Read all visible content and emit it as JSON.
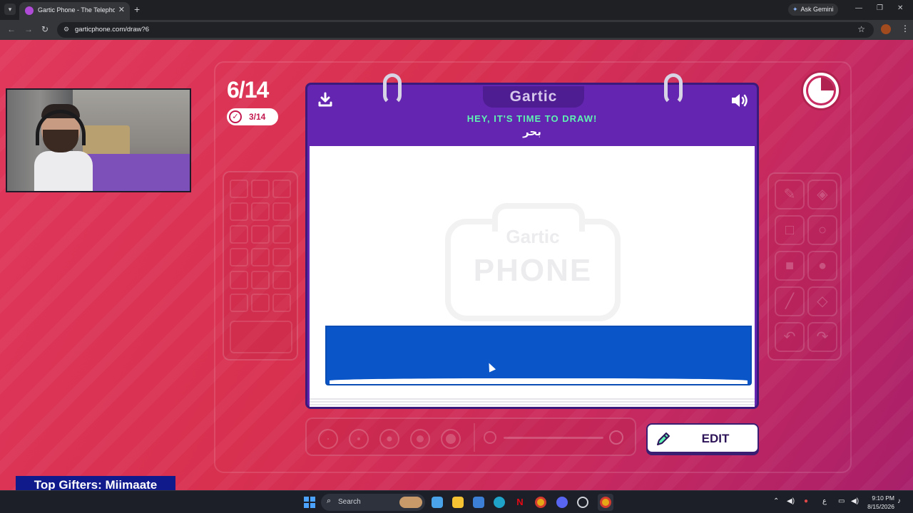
{
  "browser": {
    "tab_title": "Gartic Phone - The Telephone G",
    "url": "garticphone.com/draw?6",
    "gemini_label": "Ask Gemini",
    "icons": [
      "tab-search-icon",
      "close-icon",
      "plus-icon",
      "back-icon",
      "forward-icon",
      "reload-icon",
      "site-info-icon",
      "star-icon",
      "profile-avatar",
      "more-icon"
    ]
  },
  "game": {
    "round": "6/14",
    "done_count": "3/14",
    "logo": "Gartic",
    "instruction": "HEY, IT'S TIME TO DRAW!",
    "prompt_word": "بحر",
    "watermark_top": "Gartic",
    "watermark_bottom": "PHONE",
    "edit_label": "EDIT",
    "timer_remaining_fraction": 0.75,
    "colors": {
      "background": "#d8304f",
      "notebook": "#6425b0",
      "instruction": "#5ef3b2",
      "drawn_sea": "#0a55c8"
    },
    "tools": [
      "pencil-icon",
      "eraser-icon",
      "rectangle-outline-icon",
      "circle-outline-icon",
      "rectangle-fill-icon",
      "circle-fill-icon",
      "line-icon",
      "bucket-icon",
      "undo-icon",
      "redo-icon"
    ]
  },
  "overlay": {
    "top_gifters": "Top Gifters: Miimaate"
  },
  "taskbar": {
    "search_label": "Search",
    "language": "ع",
    "time": "9:10 PM",
    "date": "8/15/2026"
  }
}
